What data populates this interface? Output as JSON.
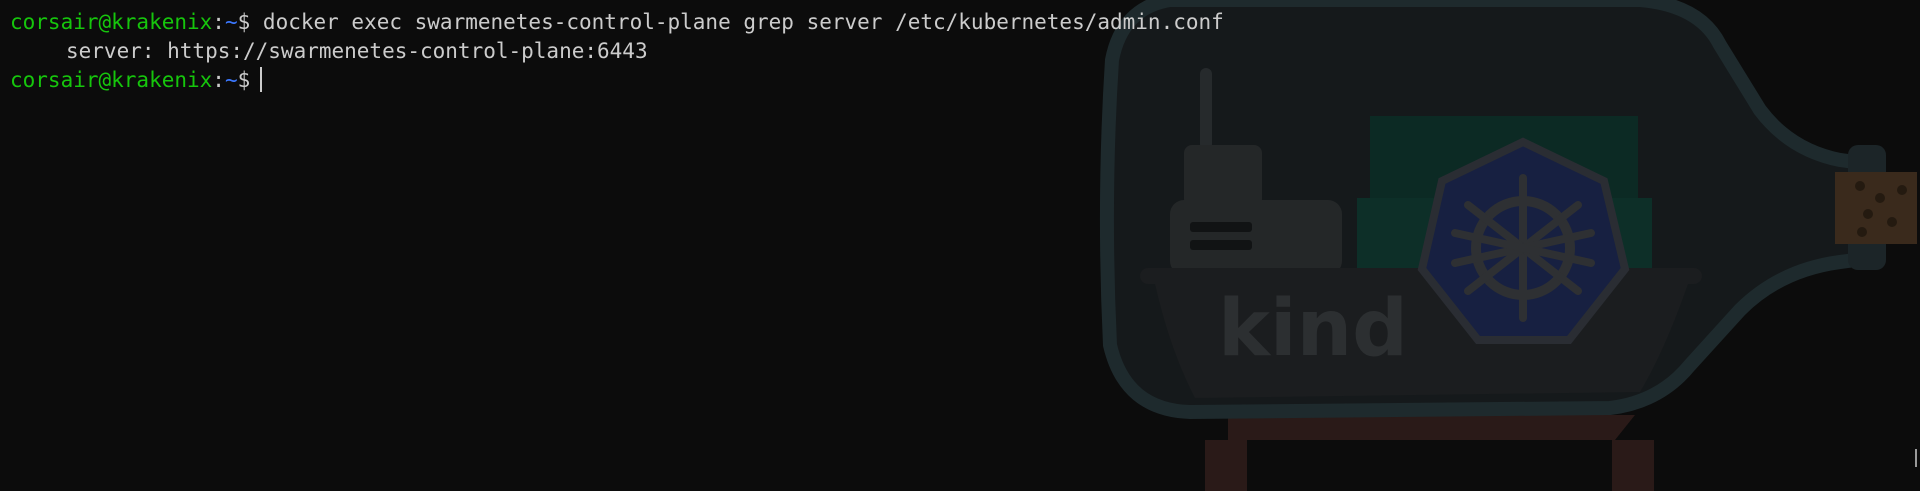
{
  "prompt": {
    "user_host": "corsair@krakenix",
    "separator": ":",
    "path": "~",
    "symbol": "$"
  },
  "lines": {
    "command_1": "docker exec swarmenetes-control-plane grep server /etc/kubernetes/admin.conf",
    "output_1": "server: https://swarmenetes-control-plane:6443"
  },
  "watermark": {
    "text": "kind",
    "icon": "kind-ship-in-bottle-logo"
  },
  "colors": {
    "background": "#0c0c0c",
    "prompt_user": "#16c60c",
    "prompt_path": "#3b78ff",
    "foreground": "#cccccc"
  }
}
